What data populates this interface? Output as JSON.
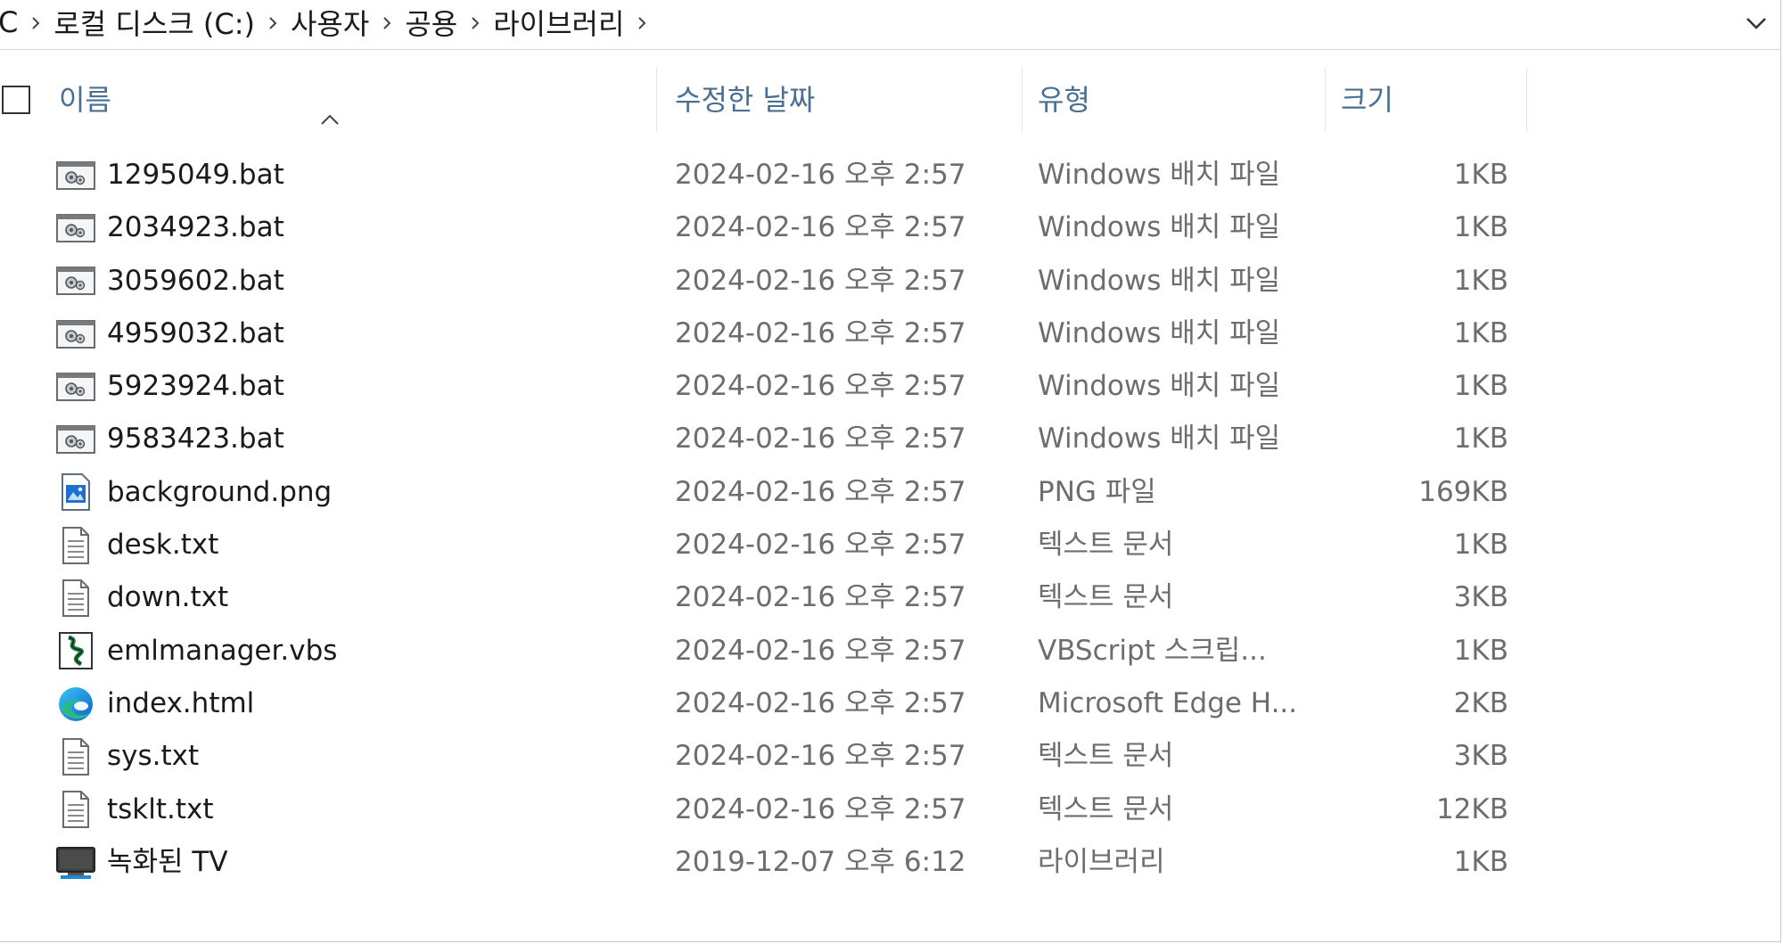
{
  "breadcrumb": {
    "items": [
      "C",
      "로컬 디스크 (C:)",
      "사용자",
      "공용",
      "라이브러리"
    ]
  },
  "columns": {
    "name": "이름",
    "date": "수정한 날짜",
    "type": "유형",
    "size": "크기",
    "sort": "ascending"
  },
  "files": [
    {
      "icon": "batch-file-icon",
      "name": "1295049.bat",
      "date": "2024-02-16 오후 2:57",
      "type": "Windows 배치 파일",
      "size": "1KB"
    },
    {
      "icon": "batch-file-icon",
      "name": "2034923.bat",
      "date": "2024-02-16 오후 2:57",
      "type": "Windows 배치 파일",
      "size": "1KB"
    },
    {
      "icon": "batch-file-icon",
      "name": "3059602.bat",
      "date": "2024-02-16 오후 2:57",
      "type": "Windows 배치 파일",
      "size": "1KB"
    },
    {
      "icon": "batch-file-icon",
      "name": "4959032.bat",
      "date": "2024-02-16 오후 2:57",
      "type": "Windows 배치 파일",
      "size": "1KB"
    },
    {
      "icon": "batch-file-icon",
      "name": "5923924.bat",
      "date": "2024-02-16 오후 2:57",
      "type": "Windows 배치 파일",
      "size": "1KB"
    },
    {
      "icon": "batch-file-icon",
      "name": "9583423.bat",
      "date": "2024-02-16 오후 2:57",
      "type": "Windows 배치 파일",
      "size": "1KB"
    },
    {
      "icon": "png-file-icon",
      "name": "background.png",
      "date": "2024-02-16 오후 2:57",
      "type": "PNG 파일",
      "size": "169KB"
    },
    {
      "icon": "text-file-icon",
      "name": "desk.txt",
      "date": "2024-02-16 오후 2:57",
      "type": "텍스트 문서",
      "size": "1KB"
    },
    {
      "icon": "text-file-icon",
      "name": "down.txt",
      "date": "2024-02-16 오후 2:57",
      "type": "텍스트 문서",
      "size": "3KB"
    },
    {
      "icon": "vbscript-file-icon",
      "name": "emlmanager.vbs",
      "date": "2024-02-16 오후 2:57",
      "type": "VBScript 스크립...",
      "size": "1KB"
    },
    {
      "icon": "edge-html-icon",
      "name": "index.html",
      "date": "2024-02-16 오후 2:57",
      "type": "Microsoft Edge H...",
      "size": "2KB"
    },
    {
      "icon": "text-file-icon",
      "name": "sys.txt",
      "date": "2024-02-16 오후 2:57",
      "type": "텍스트 문서",
      "size": "3KB"
    },
    {
      "icon": "text-file-icon",
      "name": "tsklt.txt",
      "date": "2024-02-16 오후 2:57",
      "type": "텍스트 문서",
      "size": "12KB"
    },
    {
      "icon": "recorded-tv-icon",
      "name": "녹화된 TV",
      "date": "2019-12-07 오후 6:12",
      "type": "라이브러리",
      "size": "1KB"
    }
  ],
  "colors": {
    "header_text": "#4a6f93",
    "secondary_text": "#6d6d6d",
    "primary_text": "#1a1a1a"
  }
}
